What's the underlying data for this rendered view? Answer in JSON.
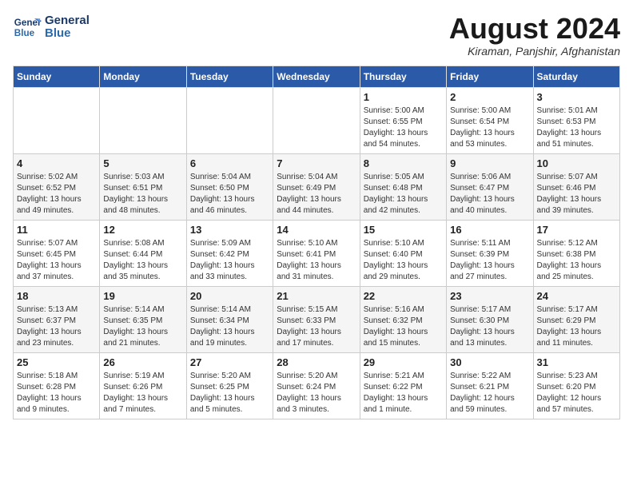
{
  "header": {
    "logo_line1": "General",
    "logo_line2": "Blue",
    "month_title": "August 2024",
    "location": "Kiraman, Panjshir, Afghanistan"
  },
  "weekdays": [
    "Sunday",
    "Monday",
    "Tuesday",
    "Wednesday",
    "Thursday",
    "Friday",
    "Saturday"
  ],
  "weeks": [
    [
      {
        "day": "",
        "info": ""
      },
      {
        "day": "",
        "info": ""
      },
      {
        "day": "",
        "info": ""
      },
      {
        "day": "",
        "info": ""
      },
      {
        "day": "1",
        "info": "Sunrise: 5:00 AM\nSunset: 6:55 PM\nDaylight: 13 hours\nand 54 minutes."
      },
      {
        "day": "2",
        "info": "Sunrise: 5:00 AM\nSunset: 6:54 PM\nDaylight: 13 hours\nand 53 minutes."
      },
      {
        "day": "3",
        "info": "Sunrise: 5:01 AM\nSunset: 6:53 PM\nDaylight: 13 hours\nand 51 minutes."
      }
    ],
    [
      {
        "day": "4",
        "info": "Sunrise: 5:02 AM\nSunset: 6:52 PM\nDaylight: 13 hours\nand 49 minutes."
      },
      {
        "day": "5",
        "info": "Sunrise: 5:03 AM\nSunset: 6:51 PM\nDaylight: 13 hours\nand 48 minutes."
      },
      {
        "day": "6",
        "info": "Sunrise: 5:04 AM\nSunset: 6:50 PM\nDaylight: 13 hours\nand 46 minutes."
      },
      {
        "day": "7",
        "info": "Sunrise: 5:04 AM\nSunset: 6:49 PM\nDaylight: 13 hours\nand 44 minutes."
      },
      {
        "day": "8",
        "info": "Sunrise: 5:05 AM\nSunset: 6:48 PM\nDaylight: 13 hours\nand 42 minutes."
      },
      {
        "day": "9",
        "info": "Sunrise: 5:06 AM\nSunset: 6:47 PM\nDaylight: 13 hours\nand 40 minutes."
      },
      {
        "day": "10",
        "info": "Sunrise: 5:07 AM\nSunset: 6:46 PM\nDaylight: 13 hours\nand 39 minutes."
      }
    ],
    [
      {
        "day": "11",
        "info": "Sunrise: 5:07 AM\nSunset: 6:45 PM\nDaylight: 13 hours\nand 37 minutes."
      },
      {
        "day": "12",
        "info": "Sunrise: 5:08 AM\nSunset: 6:44 PM\nDaylight: 13 hours\nand 35 minutes."
      },
      {
        "day": "13",
        "info": "Sunrise: 5:09 AM\nSunset: 6:42 PM\nDaylight: 13 hours\nand 33 minutes."
      },
      {
        "day": "14",
        "info": "Sunrise: 5:10 AM\nSunset: 6:41 PM\nDaylight: 13 hours\nand 31 minutes."
      },
      {
        "day": "15",
        "info": "Sunrise: 5:10 AM\nSunset: 6:40 PM\nDaylight: 13 hours\nand 29 minutes."
      },
      {
        "day": "16",
        "info": "Sunrise: 5:11 AM\nSunset: 6:39 PM\nDaylight: 13 hours\nand 27 minutes."
      },
      {
        "day": "17",
        "info": "Sunrise: 5:12 AM\nSunset: 6:38 PM\nDaylight: 13 hours\nand 25 minutes."
      }
    ],
    [
      {
        "day": "18",
        "info": "Sunrise: 5:13 AM\nSunset: 6:37 PM\nDaylight: 13 hours\nand 23 minutes."
      },
      {
        "day": "19",
        "info": "Sunrise: 5:14 AM\nSunset: 6:35 PM\nDaylight: 13 hours\nand 21 minutes."
      },
      {
        "day": "20",
        "info": "Sunrise: 5:14 AM\nSunset: 6:34 PM\nDaylight: 13 hours\nand 19 minutes."
      },
      {
        "day": "21",
        "info": "Sunrise: 5:15 AM\nSunset: 6:33 PM\nDaylight: 13 hours\nand 17 minutes."
      },
      {
        "day": "22",
        "info": "Sunrise: 5:16 AM\nSunset: 6:32 PM\nDaylight: 13 hours\nand 15 minutes."
      },
      {
        "day": "23",
        "info": "Sunrise: 5:17 AM\nSunset: 6:30 PM\nDaylight: 13 hours\nand 13 minutes."
      },
      {
        "day": "24",
        "info": "Sunrise: 5:17 AM\nSunset: 6:29 PM\nDaylight: 13 hours\nand 11 minutes."
      }
    ],
    [
      {
        "day": "25",
        "info": "Sunrise: 5:18 AM\nSunset: 6:28 PM\nDaylight: 13 hours\nand 9 minutes."
      },
      {
        "day": "26",
        "info": "Sunrise: 5:19 AM\nSunset: 6:26 PM\nDaylight: 13 hours\nand 7 minutes."
      },
      {
        "day": "27",
        "info": "Sunrise: 5:20 AM\nSunset: 6:25 PM\nDaylight: 13 hours\nand 5 minutes."
      },
      {
        "day": "28",
        "info": "Sunrise: 5:20 AM\nSunset: 6:24 PM\nDaylight: 13 hours\nand 3 minutes."
      },
      {
        "day": "29",
        "info": "Sunrise: 5:21 AM\nSunset: 6:22 PM\nDaylight: 13 hours\nand 1 minute."
      },
      {
        "day": "30",
        "info": "Sunrise: 5:22 AM\nSunset: 6:21 PM\nDaylight: 12 hours\nand 59 minutes."
      },
      {
        "day": "31",
        "info": "Sunrise: 5:23 AM\nSunset: 6:20 PM\nDaylight: 12 hours\nand 57 minutes."
      }
    ]
  ]
}
